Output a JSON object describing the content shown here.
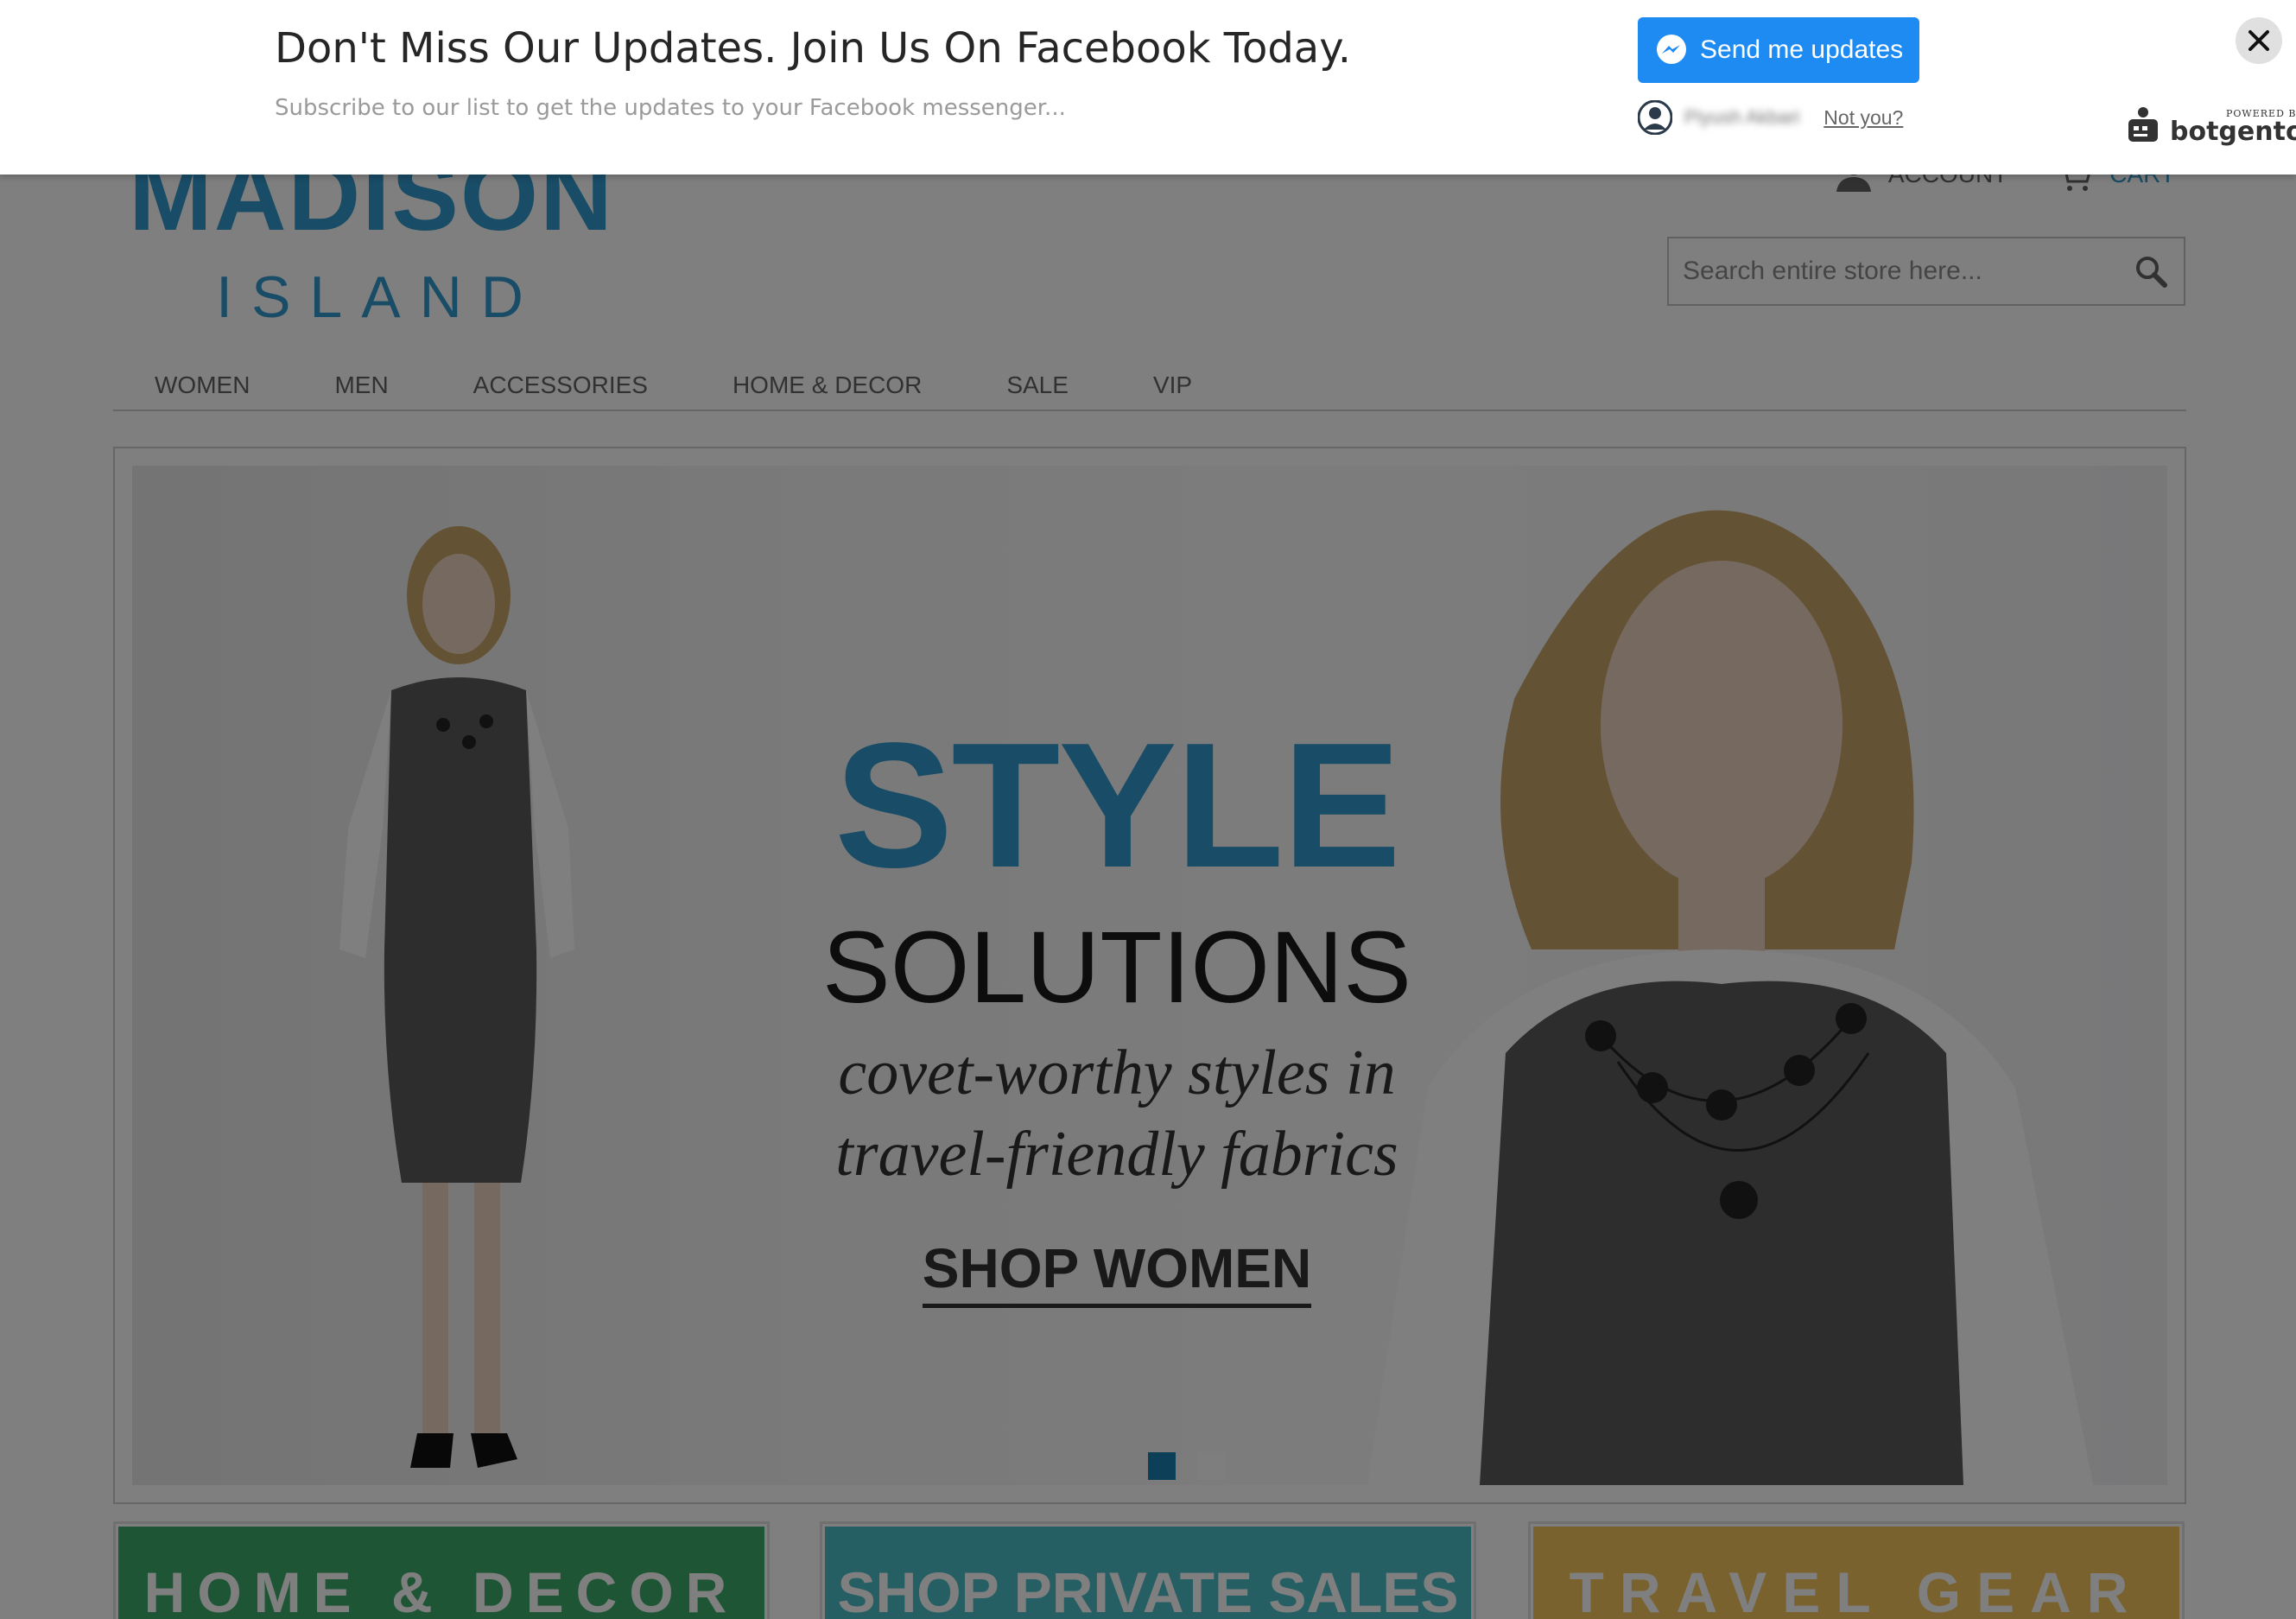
{
  "colors": {
    "brand_blue": "#3399cc",
    "messenger_blue": "#1e8bf2",
    "home_decor_green": "#3cad6a",
    "private_sales_teal": "#4cbec7",
    "travel_gear_yellow": "#f4c55d"
  },
  "optin_bar": {
    "title": "Don't Miss Our Updates. Join Us On Facebook Today.",
    "subtitle": "Subscribe to our list to get the updates to your Facebook messenger...",
    "send_button_label": "Send me updates",
    "send_button_icon": "messenger-icon",
    "user_name": "Piyush Akbari",
    "not_you_link": "Not you?",
    "close_icon": "close-icon",
    "powered_by": "POWERED BY",
    "brand_name": "botgento"
  },
  "store": {
    "logo_top": "MADISON",
    "logo_bottom": "ISLAND",
    "header_links": [
      {
        "label": "ACCOUNT",
        "icon": "user-icon"
      },
      {
        "label": "CART",
        "icon": "cart-icon"
      }
    ],
    "search": {
      "placeholder": "Search entire store here...",
      "icon": "search-icon"
    },
    "nav": [
      "WOMEN",
      "MEN",
      "ACCESSORIES",
      "HOME & DECOR",
      "SALE",
      "VIP"
    ],
    "hero": {
      "heading": "STYLE",
      "subheading": "SOLUTIONS",
      "tagline_line1": "covet-worthy styles in",
      "tagline_line2": "travel-friendly fabrics",
      "cta": "SHOP WOMEN",
      "slide_count": 2,
      "active_slide": 1
    },
    "promos": [
      "HOME & DECOR",
      "SHOP PRIVATE SALES",
      "TRAVEL GEAR"
    ]
  }
}
